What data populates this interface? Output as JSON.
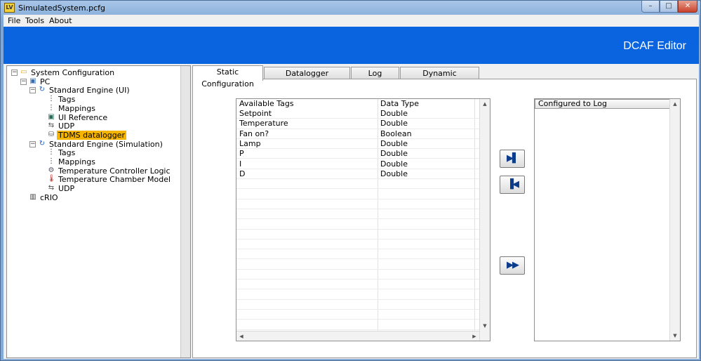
{
  "window": {
    "title": "SimulatedSystem.pcfg",
    "app_icon": "labview-icon",
    "minimize": "–",
    "maximize": "□",
    "close": "✕"
  },
  "menu": [
    "File",
    "Tools",
    "About"
  ],
  "banner": {
    "title": "DCAF Editor",
    "color": "#0a64e0"
  },
  "tree": [
    {
      "label": "System Configuration",
      "icon": "folder-icon",
      "depth": 0,
      "expander": "−"
    },
    {
      "label": "PC",
      "icon": "computer-icon",
      "depth": 1,
      "expander": "−"
    },
    {
      "label": "Standard Engine (UI)",
      "icon": "engine-icon",
      "depth": 2,
      "expander": "−"
    },
    {
      "label": "Tags",
      "icon": "tags-icon",
      "depth": 3
    },
    {
      "label": "Mappings",
      "icon": "mappings-icon",
      "depth": 3
    },
    {
      "label": "UI Reference",
      "icon": "monitor-icon",
      "depth": 3
    },
    {
      "label": "UDP",
      "icon": "network-icon",
      "depth": 3
    },
    {
      "label": "TDMS datalogger",
      "icon": "database-icon",
      "depth": 3,
      "selected": true
    },
    {
      "label": "Standard Engine (Simulation)",
      "icon": "engine-icon",
      "depth": 2,
      "expander": "−"
    },
    {
      "label": "Tags",
      "icon": "tags-icon",
      "depth": 3
    },
    {
      "label": "Mappings",
      "icon": "mappings-icon",
      "depth": 3
    },
    {
      "label": "Temperature Controller Logic",
      "icon": "gear-icon",
      "depth": 3
    },
    {
      "label": "Temperature Chamber Model",
      "icon": "thermometer-icon",
      "depth": 3
    },
    {
      "label": "UDP",
      "icon": "network-icon",
      "depth": 3
    },
    {
      "label": "cRIO",
      "icon": "crio-icon",
      "depth": 1
    }
  ],
  "tabs": [
    {
      "label": "Static Configuration",
      "active": true
    },
    {
      "label": "Datalogger Configuration"
    },
    {
      "label": "Log Rotation"
    },
    {
      "label": "Dynamic Configuration"
    }
  ],
  "available_tags": {
    "headers": [
      "Available Tags",
      "Data Type"
    ],
    "rows": [
      [
        "Setpoint",
        "Double"
      ],
      [
        "Temperature",
        "Double"
      ],
      [
        "Fan on?",
        "Boolean"
      ],
      [
        "Lamp",
        "Double"
      ],
      [
        "P",
        "Double"
      ],
      [
        "I",
        "Double"
      ],
      [
        "D",
        "Double"
      ]
    ]
  },
  "buttons": {
    "add": "▶▌",
    "remove": "▐◀",
    "add_all": "▶▶"
  },
  "configured": {
    "header": "Configured to Log"
  },
  "scroll": {
    "up": "▲",
    "down": "▼",
    "left": "◀",
    "right": "▶"
  }
}
